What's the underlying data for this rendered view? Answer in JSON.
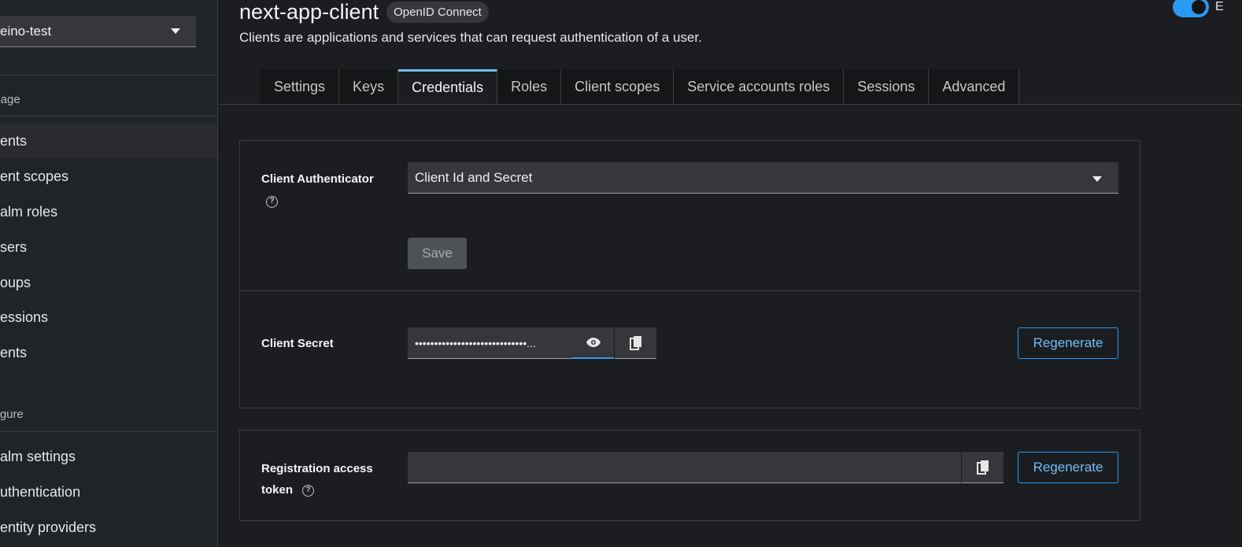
{
  "sidebar": {
    "realm": "eino-test",
    "sections": {
      "manage": "anage",
      "configure": "nfigure"
    },
    "manage_items": [
      {
        "label": "ents"
      },
      {
        "label": "ent scopes"
      },
      {
        "label": "alm roles"
      },
      {
        "label": "sers"
      },
      {
        "label": "oups"
      },
      {
        "label": "essions"
      },
      {
        "label": "ents"
      }
    ],
    "configure_items": [
      {
        "label": "alm settings"
      },
      {
        "label": "uthentication"
      },
      {
        "label": "entity providers"
      }
    ]
  },
  "header": {
    "title": "next-app-client",
    "badge": "OpenID Connect",
    "subtitle": "Clients are applications and services that can request authentication of a user.",
    "toggle_label": "E",
    "toggle_on": true
  },
  "tabs": [
    {
      "label": "Settings"
    },
    {
      "label": "Keys"
    },
    {
      "label": "Credentials"
    },
    {
      "label": "Roles"
    },
    {
      "label": "Client scopes"
    },
    {
      "label": "Service accounts roles"
    },
    {
      "label": "Sessions"
    },
    {
      "label": "Advanced"
    }
  ],
  "active_tab": "Credentials",
  "credentials": {
    "authenticator_label": "Client Authenticator",
    "authenticator_value": "Client Id and Secret",
    "save_label": "Save",
    "secret_label": "Client Secret",
    "secret_value": "•••••••••••••••••••••••••••••...",
    "regenerate_label": "Regenerate",
    "token_label_line1": "Registration access",
    "token_label_line2": "token",
    "token_value": "",
    "token_regenerate_label": "Regenerate"
  },
  "colors": {
    "accent": "#2b9af3",
    "background": "#1b1d21",
    "sidebar": "#212427"
  }
}
